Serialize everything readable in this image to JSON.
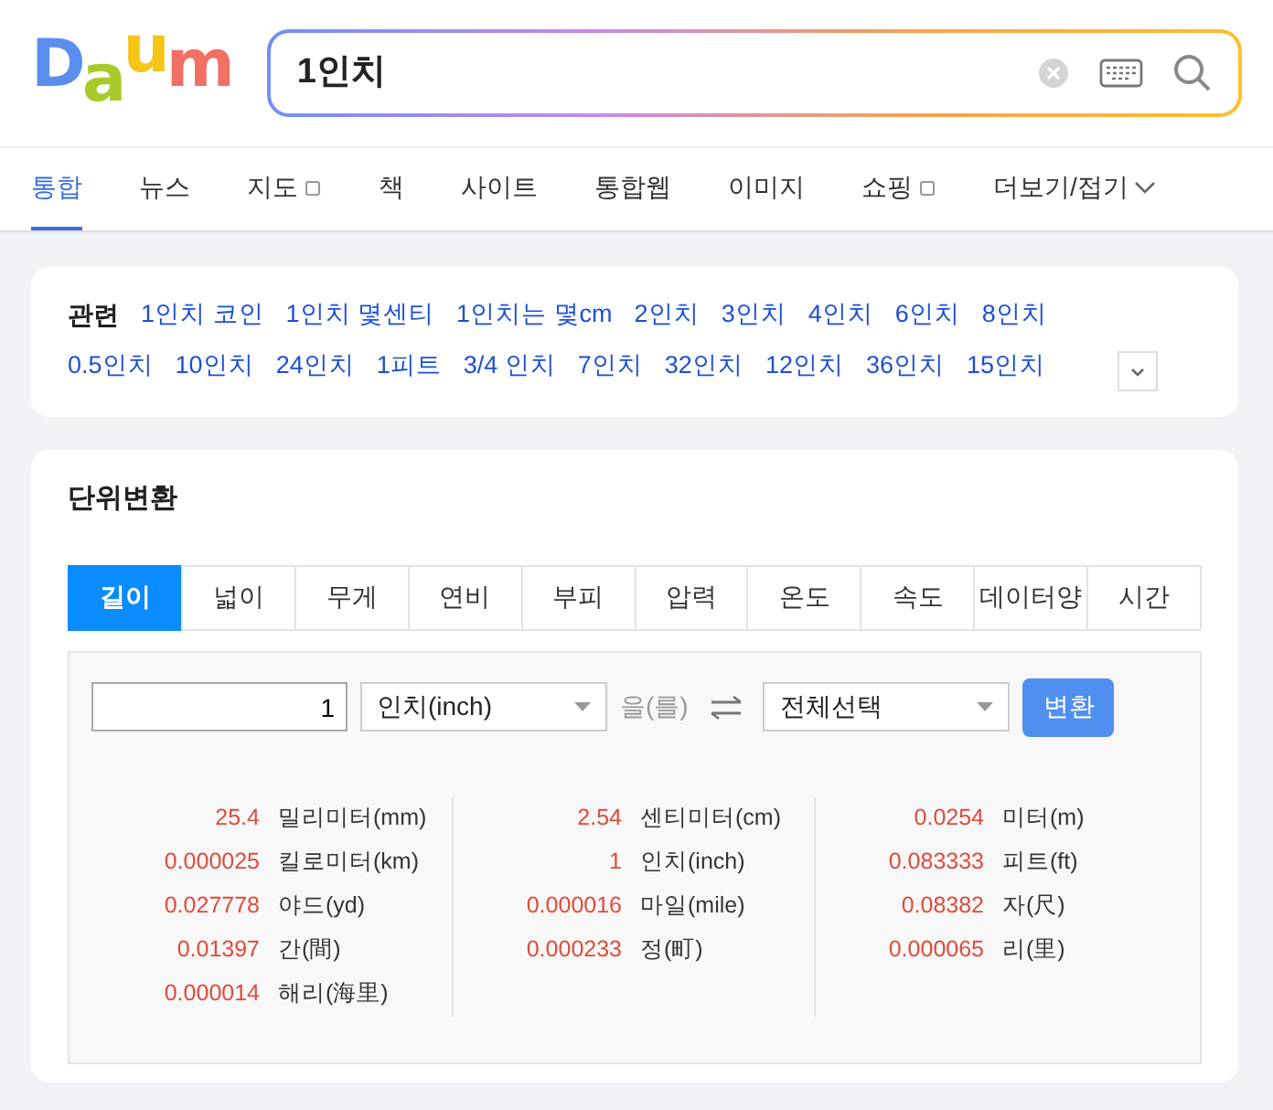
{
  "logo": [
    {
      "text": "D",
      "color": "#5b8def"
    },
    {
      "text": "a",
      "color": "#a9c92a"
    },
    {
      "text": "u",
      "color": "#f5c518"
    },
    {
      "text": "m",
      "color": "#f26f63"
    }
  ],
  "search": {
    "value": "1인치"
  },
  "nav": [
    {
      "label": "통합",
      "selected": true,
      "external": false
    },
    {
      "label": "뉴스",
      "selected": false,
      "external": false
    },
    {
      "label": "지도",
      "selected": false,
      "external": true
    },
    {
      "label": "책",
      "selected": false,
      "external": false
    },
    {
      "label": "사이트",
      "selected": false,
      "external": false
    },
    {
      "label": "통합웹",
      "selected": false,
      "external": false
    },
    {
      "label": "이미지",
      "selected": false,
      "external": false
    },
    {
      "label": "쇼핑",
      "selected": false,
      "external": true
    },
    {
      "label": "더보기/접기",
      "selected": false,
      "external": false,
      "kind": "more"
    }
  ],
  "related": {
    "title": "관련",
    "links": [
      "1인치 코인",
      "1인치 몇센티",
      "1인치는 몇cm",
      "2인치",
      "3인치",
      "4인치",
      "6인치",
      "8인치",
      "0.5인치",
      "10인치",
      "24인치",
      "1피트",
      "3/4 인치",
      "7인치",
      "32인치",
      "12인치",
      "36인치",
      "15인치"
    ]
  },
  "converter": {
    "title": "단위변환",
    "tabs": [
      {
        "label": "길이",
        "selected": true
      },
      {
        "label": "넓이",
        "selected": false
      },
      {
        "label": "무게",
        "selected": false
      },
      {
        "label": "연비",
        "selected": false
      },
      {
        "label": "부피",
        "selected": false
      },
      {
        "label": "압력",
        "selected": false
      },
      {
        "label": "온도",
        "selected": false
      },
      {
        "label": "속도",
        "selected": false
      },
      {
        "label": "데이터양",
        "selected": false
      },
      {
        "label": "시간",
        "selected": false
      }
    ],
    "amount": "1",
    "from_unit": "인치(inch)",
    "particle": "을(를)",
    "to_unit": "전체선택",
    "button": "변환",
    "results": [
      [
        {
          "value": "25.4",
          "unit": "밀리미터(mm)"
        },
        {
          "value": "0.000025",
          "unit": "킬로미터(km)"
        },
        {
          "value": "0.027778",
          "unit": "야드(yd)"
        },
        {
          "value": "0.01397",
          "unit": "간(間)"
        },
        {
          "value": "0.000014",
          "unit": "해리(海里)"
        }
      ],
      [
        {
          "value": "2.54",
          "unit": "센티미터(cm)"
        },
        {
          "value": "1",
          "unit": "인치(inch)"
        },
        {
          "value": "0.000016",
          "unit": "마일(mile)"
        },
        {
          "value": "0.000233",
          "unit": "정(町)"
        }
      ],
      [
        {
          "value": "0.0254",
          "unit": "미터(m)"
        },
        {
          "value": "0.083333",
          "unit": "피트(ft)"
        },
        {
          "value": "0.08382",
          "unit": "자(尺)"
        },
        {
          "value": "0.000065",
          "unit": "리(里)"
        }
      ]
    ]
  }
}
